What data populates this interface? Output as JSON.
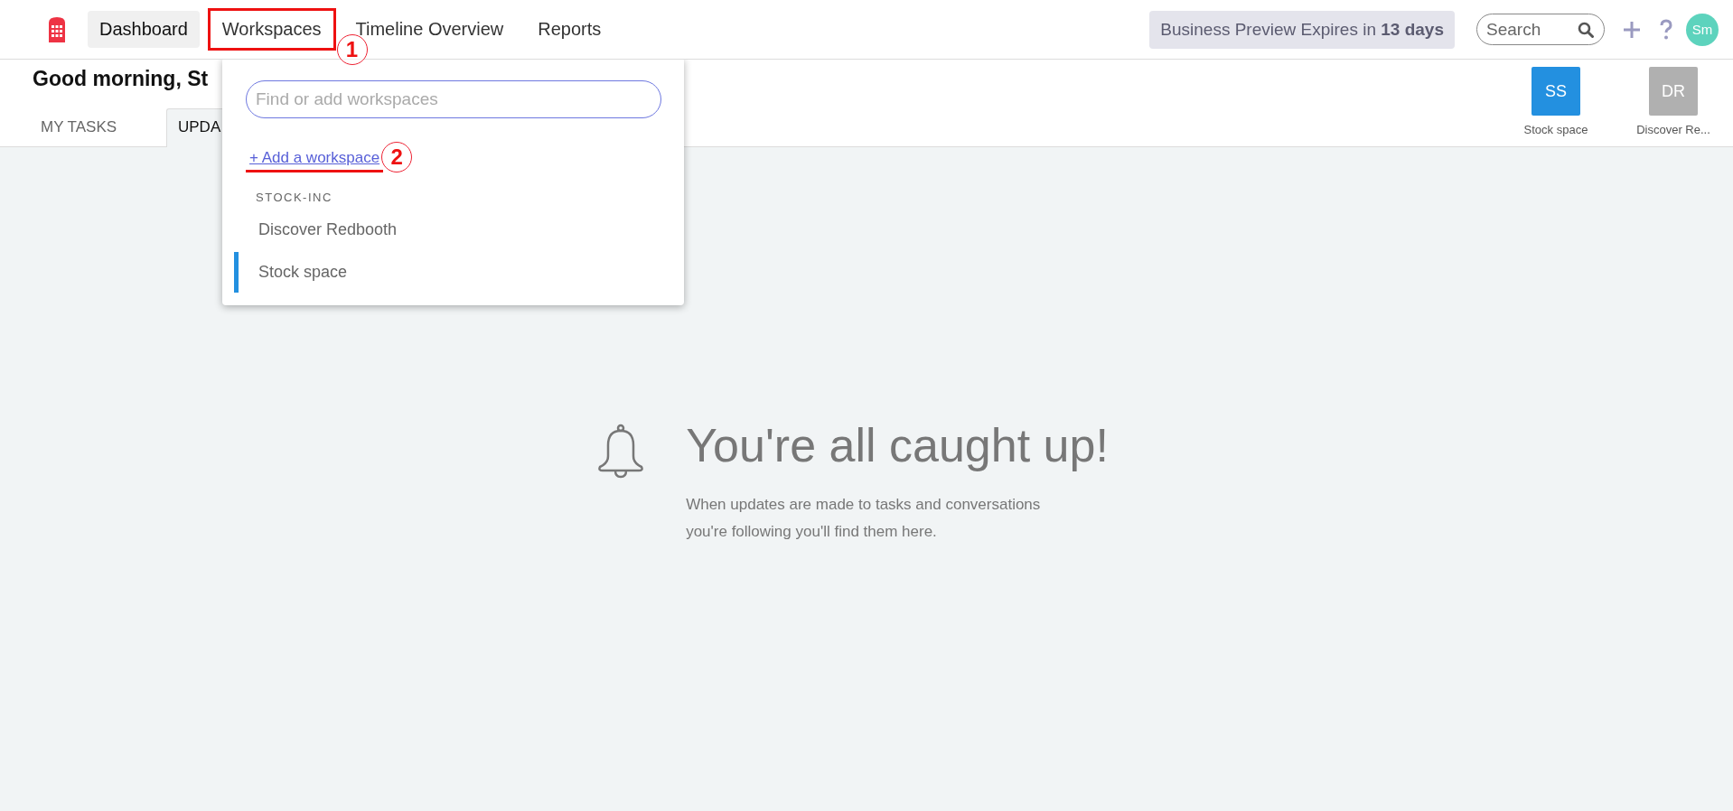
{
  "topbar": {
    "nav": [
      {
        "label": "Dashboard",
        "selected": true
      },
      {
        "label": "Workspaces",
        "selected": false,
        "callout": "1"
      },
      {
        "label": "Timeline Overview",
        "selected": false
      },
      {
        "label": "Reports",
        "selected": false
      }
    ],
    "trial_badge": "Business Preview Expires in **13 days**",
    "search": {
      "placeholder": "Search"
    },
    "user_avatar": "Sm"
  },
  "header": {
    "greeting": "Good morning, St",
    "tabs": [
      {
        "label": "MY TASKS",
        "selected": false
      },
      {
        "label": "UPDA",
        "selected": true
      }
    ],
    "workspaces": [
      {
        "initials": "SS",
        "label": "Stock space",
        "color": "#2390e0"
      },
      {
        "initials": "DR",
        "label": "Discover Re...",
        "color": "#b0b0b0"
      }
    ]
  },
  "workspace_menu": {
    "search": {
      "placeholder": "Find or add workspaces"
    },
    "add_link": {
      "label": "+ Add a workspace",
      "callout": "2"
    },
    "group": "STOCK-INC",
    "items": [
      {
        "label": "Discover Redbooth",
        "selected": false
      },
      {
        "label": "Stock space",
        "selected": true
      }
    ]
  },
  "empty_state": {
    "title": "You're all caught up!",
    "message": "When updates are made to tasks and conversations you're following you'll find them here."
  }
}
